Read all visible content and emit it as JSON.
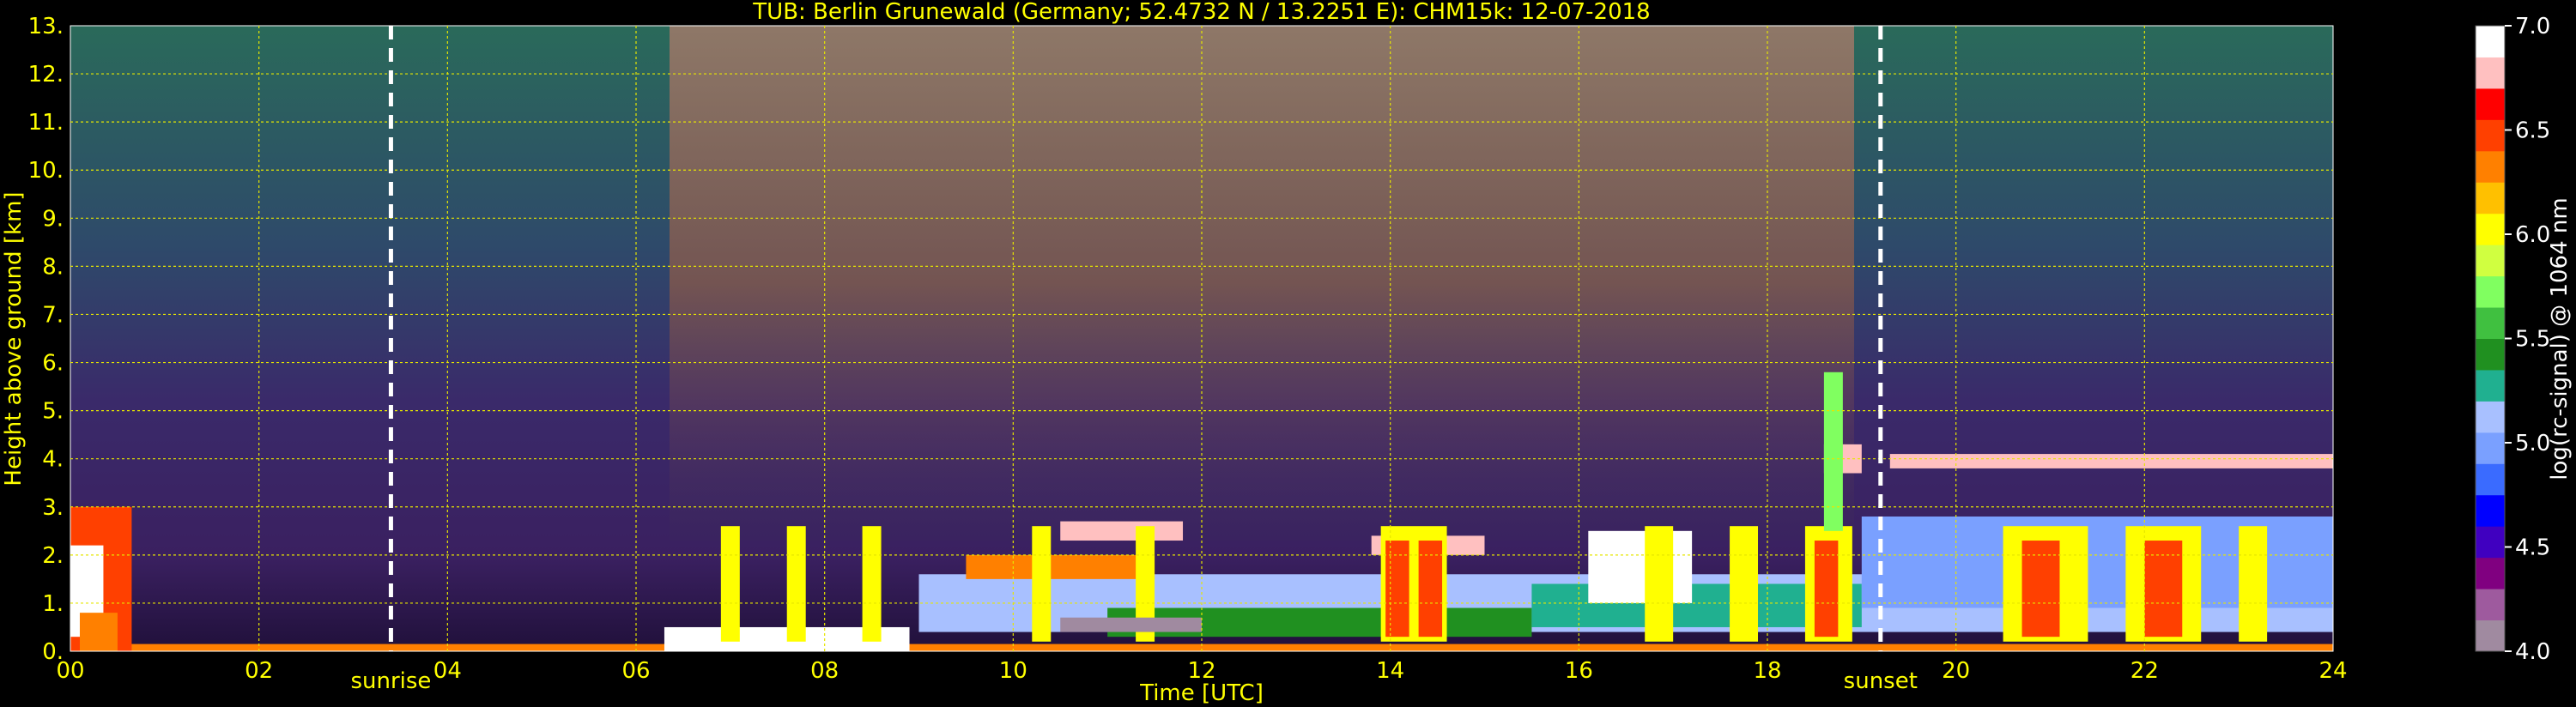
{
  "chart_data": {
    "type": "heatmap",
    "title": "TUB: Berlin Grunewald (Germany; 52.4732 N / 13.2251 E):    CHM15k: 12-07-2018",
    "xlabel": "Time [UTC]",
    "ylabel": "Height above ground [km]",
    "colorbar_label": "log(rc-signal) @ 1064 nm",
    "xlim": [
      0,
      24
    ],
    "ylim": [
      0,
      13
    ],
    "clim": [
      4.0,
      7.0
    ],
    "x_ticks": [
      "00",
      "02",
      "04",
      "06",
      "08",
      "10",
      "12",
      "14",
      "16",
      "18",
      "20",
      "22",
      "24"
    ],
    "y_ticks": [
      "0.",
      "1.",
      "2.",
      "3.",
      "4.",
      "5.",
      "6.",
      "7.",
      "8.",
      "9.",
      "10.",
      "11.",
      "12.",
      "13."
    ],
    "colorbar_ticks": [
      "4.0",
      "4.5",
      "5.0",
      "5.5",
      "6.0",
      "6.5",
      "7.0"
    ],
    "grid": true,
    "annotations": [
      {
        "text": "sunrise",
        "x": 3.4
      },
      {
        "text": "sunset",
        "x": 19.2
      }
    ],
    "colormap": [
      "#a08aa0",
      "#9e5a9e",
      "#800080",
      "#4000c0",
      "#0000ff",
      "#3a6bff",
      "#7aa0ff",
      "#a8c0ff",
      "#20b090",
      "#209020",
      "#40c040",
      "#80ff60",
      "#d0ff40",
      "#ffff00",
      "#ffc000",
      "#ff8000",
      "#ff4000",
      "#ff0000",
      "#ffc0c0",
      "#ffffff"
    ]
  }
}
